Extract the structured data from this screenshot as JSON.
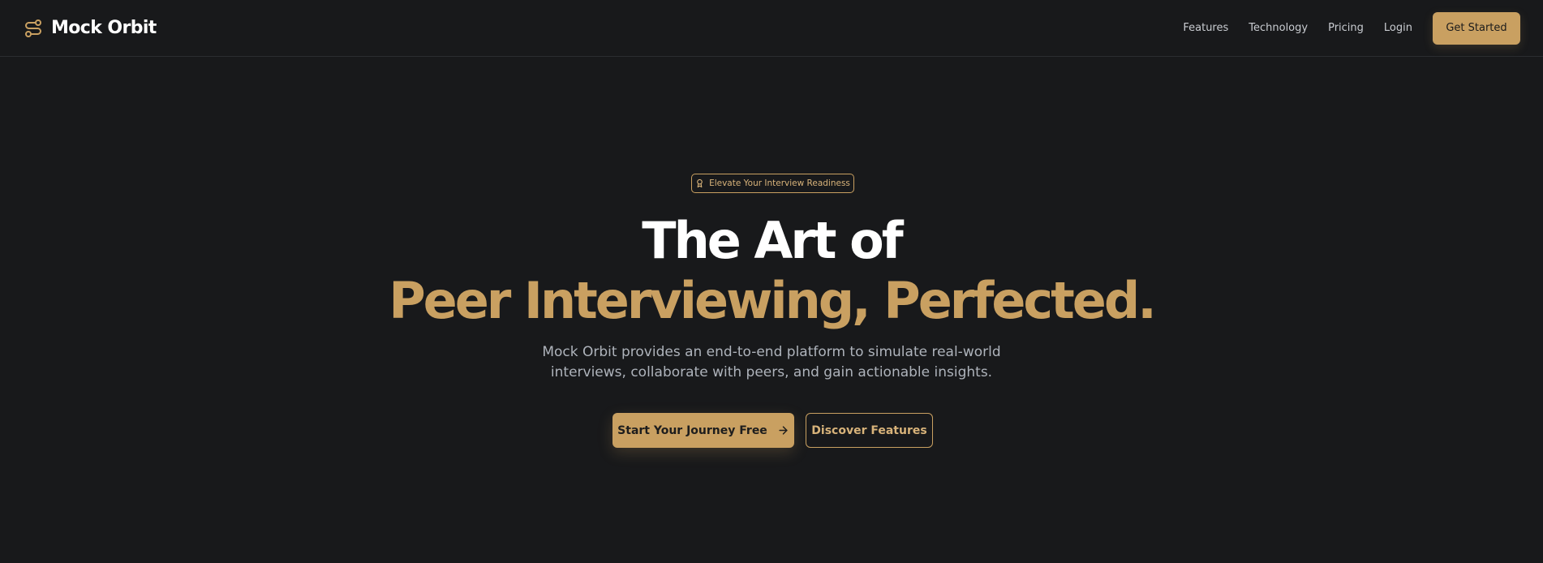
{
  "brand": {
    "name": "Mock Orbit",
    "icon": "route-icon",
    "accent": "#c9a061"
  },
  "nav": {
    "links": [
      "Features",
      "Technology",
      "Pricing",
      "Login"
    ],
    "cta": "Get Started"
  },
  "hero": {
    "badge": {
      "icon": "award-icon",
      "text": "Elevate Your Interview Readiness"
    },
    "title_line1": "The Art of",
    "title_line2": "Peer Interviewing, Perfected.",
    "subtitle_line1": "Mock Orbit provides an end-to-end platform to simulate real-world",
    "subtitle_line2": "interviews, collaborate with peers, and gain actionable insights.",
    "primary_button": {
      "label": "Start Your Journey Free",
      "icon": "arrow-right-icon"
    },
    "secondary_button": {
      "label": "Discover Features"
    }
  },
  "colors": {
    "background": "#18191b",
    "accent": "#c9a061",
    "text_primary": "#ffffff",
    "text_muted": "#aeb3bb"
  }
}
